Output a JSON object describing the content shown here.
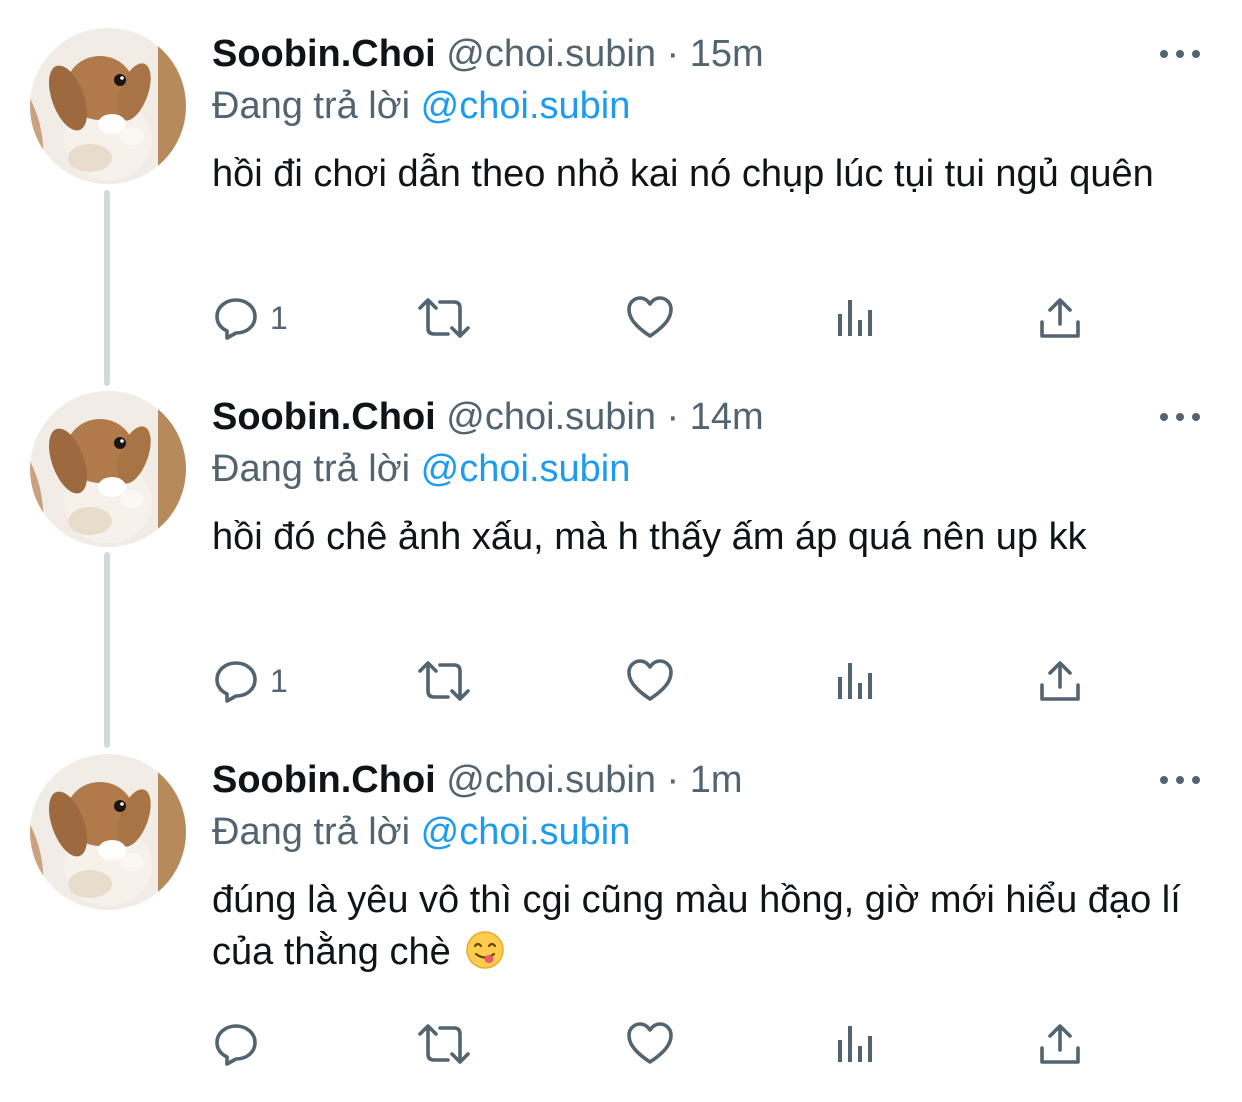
{
  "tweets": [
    {
      "name": "Soobin.Choi",
      "handle": "@choi.subin",
      "separator": "·",
      "time": "15m",
      "replying_prefix": "Đang trả lời",
      "replying_to": "@choi.subin",
      "text": "hồi đi chơi dẫn theo nhỏ kai nó chụp lúc tụi tui ngủ quên",
      "reply_count": "1"
    },
    {
      "name": "Soobin.Choi",
      "handle": "@choi.subin",
      "separator": "·",
      "time": "14m",
      "replying_prefix": "Đang trả lời",
      "replying_to": "@choi.subin",
      "text": "hồi đó chê ảnh xấu, mà h thấy ấm áp quá nên up kk",
      "reply_count": "1"
    },
    {
      "name": "Soobin.Choi",
      "handle": "@choi.subin",
      "separator": "·",
      "time": "1m",
      "replying_prefix": "Đang trả lời",
      "replying_to": "@choi.subin",
      "text": "đúng là yêu vô thì cgi cũng màu hồng, giờ mới hiểu đạo lí của thằng chè",
      "reply_count": ""
    }
  ],
  "colors": {
    "text": "#0f1419",
    "secondary": "#536471",
    "link": "#1d9bf0",
    "thread_line": "#cfd9de"
  },
  "icons": [
    "more-icon",
    "reply-icon",
    "retweet-icon",
    "like-icon",
    "analytics-icon",
    "share-icon",
    "yum-face-emoji"
  ]
}
